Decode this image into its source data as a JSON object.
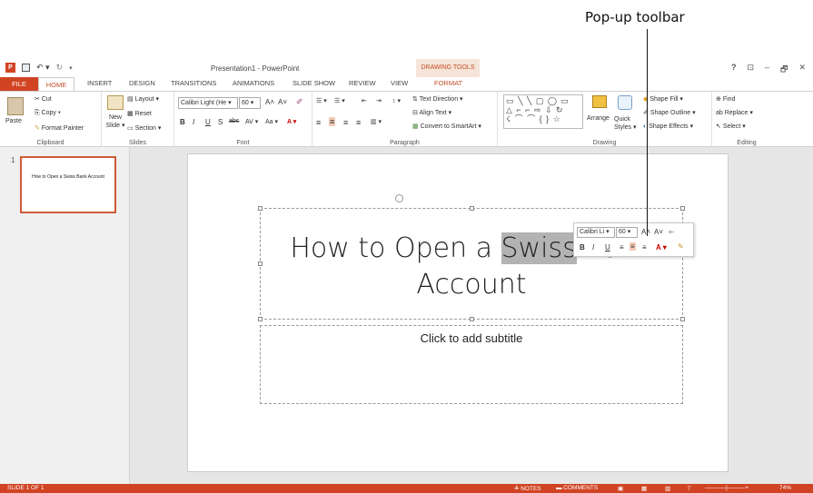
{
  "callout": "Pop-up toolbar",
  "titlebar": {
    "app_icon": "P",
    "save_icon": "save-icon",
    "undo": "↶ ▾",
    "redo": "↻",
    "customize": "▾",
    "doc_title": "Presentation1 - PowerPoint",
    "drawing_tools": "DRAWING TOOLS",
    "help": "?",
    "ribbon_display": "⊡",
    "minimize": "–",
    "restore": "🗗",
    "close": "✕"
  },
  "tabs": {
    "file": "FILE",
    "home": "HOME",
    "insert": "INSERT",
    "design": "DESIGN",
    "transitions": "TRANSITIONS",
    "animations": "ANIMATIONS",
    "slideshow": "SLIDE SHOW",
    "review": "REVIEW",
    "view": "VIEW",
    "format": "FORMAT"
  },
  "ribbon": {
    "clipboard": {
      "paste": "Paste",
      "cut": "Cut",
      "copy": "Copy ▾",
      "format_painter": "Format Painter",
      "label": "Clipboard"
    },
    "slides": {
      "new_slide": "New Slide ▾",
      "layout": "Layout ▾",
      "reset": "Reset",
      "section": "Section ▾",
      "label": "Slides"
    },
    "font": {
      "font_name": "Calibri Light (He ▾",
      "font_size": "60 ▾",
      "grow": "A˄",
      "shrink": "A˅",
      "clear": "✐",
      "bold": "B",
      "italic": "I",
      "underline": "U",
      "shadow": "S",
      "strike": "abc",
      "spacing": "AV ▾",
      "case": "Aa ▾",
      "color": "A ▾",
      "label": "Font"
    },
    "paragraph": {
      "bullets": "☰ ▾",
      "numbering": "☰ ▾",
      "decrease": "⇤",
      "increase": "⇥",
      "line_spacing": "↕ ▾",
      "align_left": "≡",
      "center": "≡",
      "align_right": "≡",
      "justify": "≡",
      "columns": "▥ ▾",
      "text_direction": "Text Direction ▾",
      "align_text": "Align Text ▾",
      "convert_smartart": "Convert to SmartArt ▾",
      "label": "Paragraph"
    },
    "drawing": {
      "shapes_row1": "▭ ╲ ╲ ▢ ◯ ▭",
      "shapes_row2": "△ ⌐ ⌐ ⇨ ⇩ ↻",
      "shapes_row3": "☇ ⌒ ⌒ { } ☆",
      "arrange": "Arrange",
      "quick_styles": "Quick Styles ▾",
      "shape_fill": "Shape Fill ▾",
      "shape_outline": "Shape Outline ▾",
      "shape_effects": "Shape Effects ▾",
      "label": "Drawing"
    },
    "editing": {
      "find": "Find",
      "replace": "Replace ▾",
      "select": "Select ▾",
      "label": "Editing"
    }
  },
  "thumbnail": {
    "number": "1",
    "title": "How to Open a Swiss Bank Account"
  },
  "slide": {
    "title_before": "How to Open a ",
    "title_highlight": "Swiss",
    "title_after": " Bank Account",
    "subtitle_placeholder": "Click to add subtitle"
  },
  "popup": {
    "font": "Calibri Li ▾",
    "size": "60 ▾",
    "grow": "A˄",
    "shrink": "A˅",
    "indent": "⇤",
    "bold": "B",
    "italic": "I",
    "underline": "U",
    "align_left": "≡",
    "center": "≡",
    "align_right": "≡",
    "color": "A ▾",
    "painter": "✎"
  },
  "status": {
    "slide_of": "SLIDE 1 OF 1",
    "notes": "≜ NOTES",
    "comments": "▬ COMMENTS",
    "zoom": "74%"
  }
}
